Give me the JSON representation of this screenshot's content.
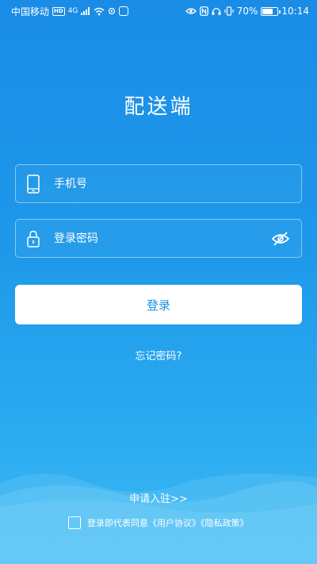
{
  "status_bar": {
    "carrier": "中国移动",
    "hd_badge": "HD",
    "network": "4G",
    "battery": "70%",
    "time": "10:14"
  },
  "app_title": "配送端",
  "phone_field": {
    "placeholder": "手机号",
    "value": "",
    "icon": "phone-icon"
  },
  "password_field": {
    "placeholder": "登录密码",
    "value": "",
    "icon": "lock-icon",
    "toggle_icon": "eye-off-icon"
  },
  "login_button": "登录",
  "forgot_password": "忘记密码?",
  "apply_link": "申请入驻>>",
  "agreement": {
    "prefix": "登录即代表同意",
    "user_agreement": "《用户协议》",
    "privacy_policy": "《隐私政策》",
    "checked": false
  },
  "colors": {
    "background_top": "#1a8ce6",
    "background_bottom": "#3cb8f3",
    "button_text": "#1b8fe6"
  }
}
